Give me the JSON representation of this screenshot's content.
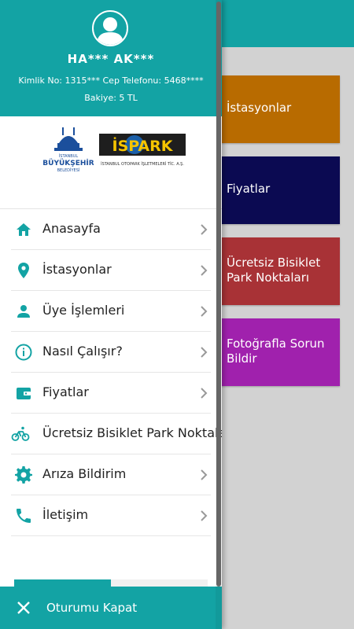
{
  "background": {
    "tiles": [
      {
        "label": "İstasyonlar",
        "color": "#b86b00"
      },
      {
        "label": "Fiyatlar",
        "color": "#0b0a52"
      },
      {
        "label": "Ücretsiz Bisiklet Park Noktaları",
        "color": "#a83236"
      },
      {
        "label": "Fotoğrafla Sorun Bildir",
        "color": "#a021ad"
      }
    ]
  },
  "drawer": {
    "header": {
      "avatar_icon": "user-avatar-icon",
      "name": "HA*** AK***",
      "ids": "Kimlik No: 1315*** Cep Telefonu: 5468****",
      "balance": "Bakiye: 5 TL"
    },
    "logos": {
      "ibb_lines": [
        "İSTANBUL",
        "BÜYÜKŞEHİR",
        "BELEDİYESİ"
      ],
      "ispark_text": "İSPARK",
      "ispark_sub": "İSTANBUL OTOPARK İŞLETMELERİ TİC. A.Ş."
    },
    "menu": [
      {
        "label": "Anasayfa",
        "icon": "home-icon"
      },
      {
        "label": "İstasyonlar",
        "icon": "location-pin-icon"
      },
      {
        "label": "Üye İşlemleri",
        "icon": "person-icon"
      },
      {
        "label": "Nasıl Çalışır?",
        "icon": "info-icon"
      },
      {
        "label": "Fiyatlar",
        "icon": "wallet-icon"
      },
      {
        "label": "Ücretsiz Bisiklet Park Noktaları",
        "icon": "bicycle-icon"
      },
      {
        "label": "Arıza Bildirim",
        "icon": "gear-icon"
      },
      {
        "label": "İletişim",
        "icon": "phone-icon"
      }
    ],
    "progress": 0.5,
    "logout_label": "Oturumu Kapat"
  },
  "colors": {
    "accent": "#13a3a4",
    "background": "#d2d2d2"
  }
}
